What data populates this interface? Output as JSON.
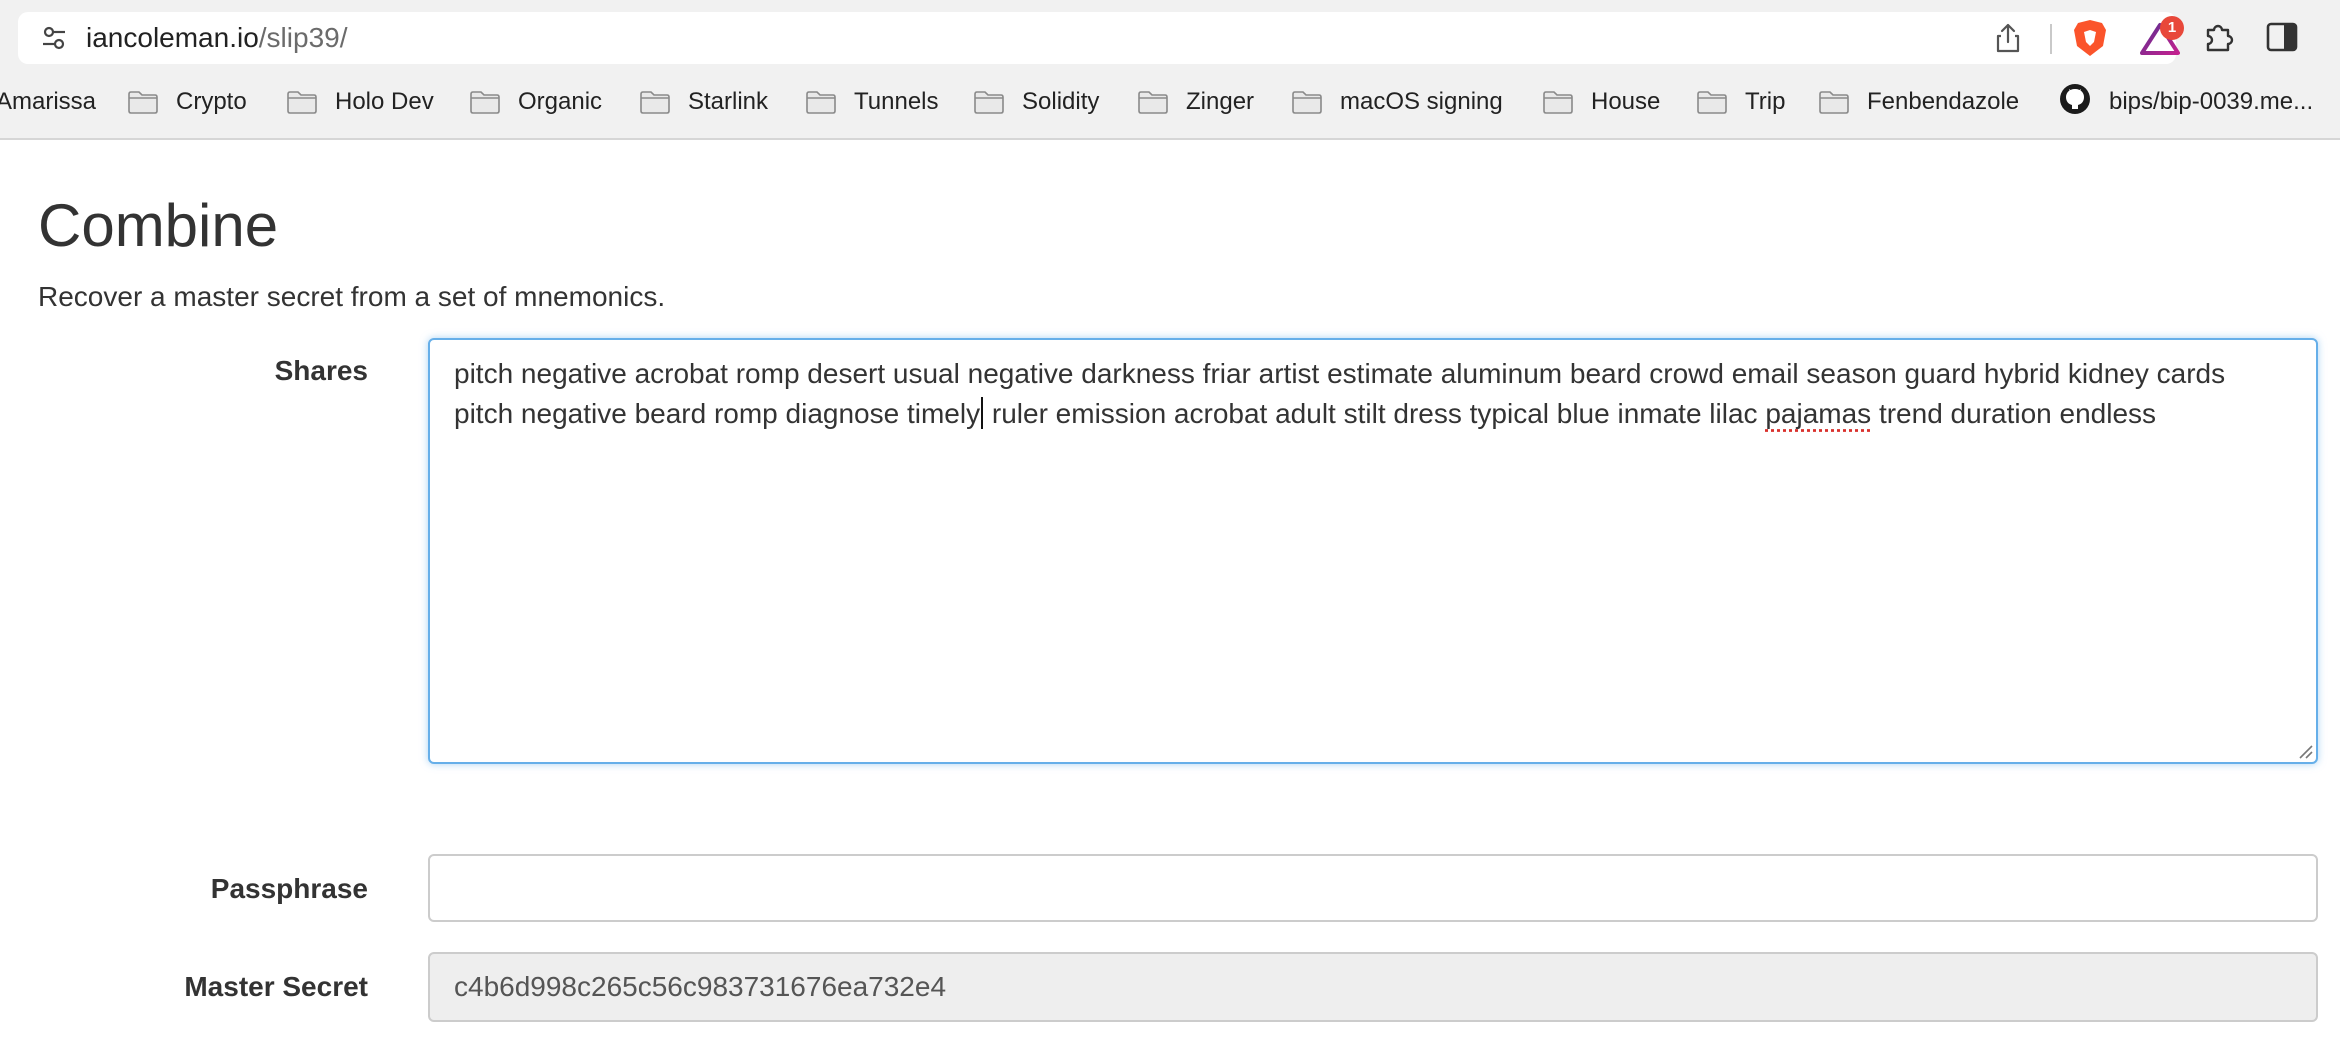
{
  "browser": {
    "url_host": "iancoleman.io",
    "url_path": "/slip39/",
    "rewards_badge": "1",
    "bookmarks": [
      {
        "label": "Amarissa",
        "icon": "none"
      },
      {
        "label": "Crypto",
        "icon": "folder-icon"
      },
      {
        "label": "Holo Dev",
        "icon": "folder-icon"
      },
      {
        "label": "Organic",
        "icon": "folder-icon"
      },
      {
        "label": "Starlink",
        "icon": "folder-icon"
      },
      {
        "label": "Tunnels",
        "icon": "folder-icon"
      },
      {
        "label": "Solidity",
        "icon": "folder-icon"
      },
      {
        "label": "Zinger",
        "icon": "folder-icon"
      },
      {
        "label": "macOS signing",
        "icon": "folder-icon"
      },
      {
        "label": "House",
        "icon": "folder-icon"
      },
      {
        "label": "Trip",
        "icon": "folder-icon"
      },
      {
        "label": "Fenbendazole",
        "icon": "folder-icon"
      },
      {
        "label": "bips/bip-0039.me...",
        "icon": "github-icon"
      }
    ]
  },
  "combine": {
    "title": "Combine",
    "subtitle": "Recover a master secret from a set of mnemonics.",
    "shares_label": "Shares",
    "shares_line1": "pitch negative acrobat romp desert usual negative darkness friar artist estimate aluminum beard crowd email season guard hybrid kidney cards",
    "shares_line2_before_caret": "pitch negative beard romp diagnose timely",
    "shares_line2_after_caret_a": " ruler emission acrobat adult stilt dress typical blue inmate lilac ",
    "shares_line2_misspelled": "pajamas",
    "shares_line2_after_caret_b": " trend duration endless",
    "passphrase_label": "Passphrase",
    "passphrase_value": "",
    "master_secret_label": "Master Secret",
    "master_secret_value": "c4b6d998c265c56c983731676ea732e4"
  },
  "colors": {
    "focus_border": "#66afe9",
    "readonly_bg": "#eeeeee",
    "badge": "#e8483a",
    "brave_orange": "#fb542b"
  }
}
